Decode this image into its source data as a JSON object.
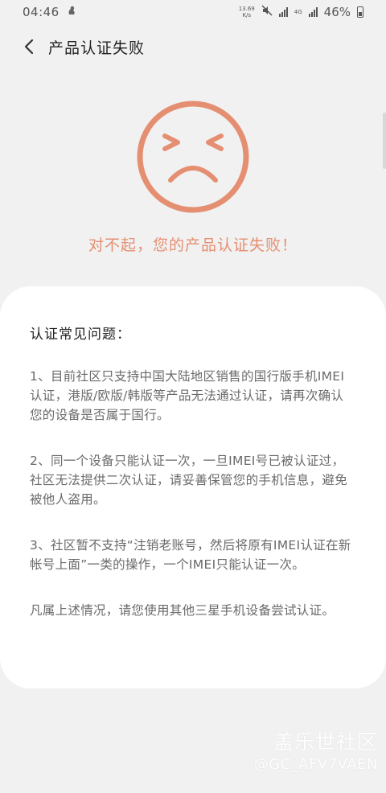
{
  "status_bar": {
    "time": "04:46",
    "net_speed_value": "13.69",
    "net_speed_unit": "K/s",
    "battery": "46%",
    "icons": [
      "notification-icon",
      "mute-icon",
      "signal-icon",
      "4g-icon",
      "battery-icon"
    ]
  },
  "header": {
    "title": "产品认证失败",
    "back_icon": "chevron-left-icon"
  },
  "result": {
    "icon": "sad-face-icon",
    "message": "对不起，您的产品认证失败！",
    "accent_color": "#e58f72"
  },
  "faq": {
    "title": "认证常见问题：",
    "items": [
      "1、目前社区只支持中国大陆地区销售的国行版手机IMEI认证，港版/欧版/韩版等产品无法通过认证，请再次确认您的设备是否属于国行。",
      "2、同一个设备只能认证一次，一旦IMEI号已被认证过，社区无法提供二次认证，请妥善保管您的手机信息，避免被他人盗用。",
      "3、社区暂不支持“注销老账号，然后将原有IMEI认证在新帐号上面”一类的操作，一个IMEI只能认证一次。",
      "凡属上述情况，请您使用其他三星手机设备尝试认证。"
    ]
  },
  "watermark": {
    "logo": "盖乐世社区",
    "user": "@GC_AFV7VAEN"
  }
}
